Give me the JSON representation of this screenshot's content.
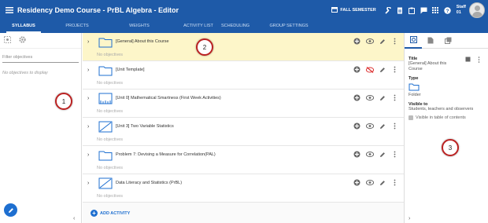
{
  "header": {
    "title": "Residency Demo Course - PrBL Algebra - Editor",
    "semester": "FALL SEMESTER",
    "staff_line1": "Staff",
    "staff_line2": "01",
    "bar_color": "#1e5aa8",
    "icons": [
      "calendar-icon",
      "wrench-icon",
      "document-icon",
      "clipboard-icon",
      "chat-icon",
      "apps-grid-icon",
      "help-icon"
    ]
  },
  "tabs": [
    {
      "label": "SYLLABUS",
      "active": true
    },
    {
      "label": "PROJECTS",
      "active": false
    },
    {
      "label": "WEIGHTS",
      "active": false
    },
    {
      "label": "ACTIVITY LIST",
      "active": false
    },
    {
      "label": "SCHEDULING",
      "active": false
    },
    {
      "label": "GROUP SETTINGS",
      "active": false
    }
  ],
  "left_panel": {
    "filter_placeholder": "Filter objectives",
    "empty_text": "No objectives to display",
    "collapse": "‹"
  },
  "activities": [
    {
      "title": "[General] About this Course",
      "subtitle": "No objectives",
      "icon": "folder-icon",
      "selected": true,
      "visible": true
    },
    {
      "title": "[Unit Template]",
      "subtitle": "No objectives",
      "icon": "folder-icon",
      "selected": false,
      "visible": false
    },
    {
      "title": "[Unit 0] Mathematical Smartness (First Week Activities)",
      "subtitle": "No objectives",
      "icon": "ruler-icon",
      "selected": false,
      "visible": true
    },
    {
      "title": "[Unit 3] Two Variable Statistics",
      "subtitle": "No objectives",
      "icon": "line-chart-icon",
      "selected": false,
      "visible": true
    },
    {
      "title": "Problem 7: Devising a Measure for Correlation(PAL)",
      "subtitle": "No objectives",
      "icon": "folder-icon",
      "selected": false,
      "visible": true
    },
    {
      "title": "Data Literacy and Statistics (PrBL)",
      "subtitle": "No objectives",
      "icon": "line-chart-icon",
      "selected": false,
      "visible": true
    }
  ],
  "add_activity": "ADD ACTIVITY",
  "right_panel": {
    "title_label": "Title",
    "title_value": "[General] About this Course",
    "type_label": "Type",
    "type_value": "Folder",
    "visible_label": "Visible to",
    "visible_value": "Students, teachers and observers",
    "toc_label": "Visible in table of contents",
    "collapse": "›"
  },
  "callouts": [
    "1",
    "2",
    "3"
  ],
  "chevron": "›"
}
